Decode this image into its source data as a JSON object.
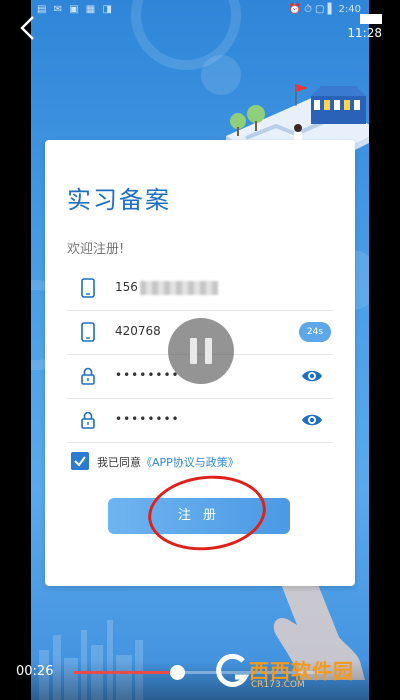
{
  "status_bar": {
    "left_icons": "▤ ✉ ▣ ▦ ◨",
    "right": "⏰ ⏱ ▢ ▌ 2:40"
  },
  "video": {
    "time_top": "11:28",
    "time_current": "00:26",
    "progress": 0.41
  },
  "page": {
    "title": "实习备案",
    "welcome": "欢迎注册!",
    "phone": "156",
    "code": "420768",
    "code_countdown": "24s",
    "password_mask": "••••••••",
    "confirm_password_mask": "••••••••",
    "agree_prefix": "我已同意",
    "agree_link": "《APP协议与政策》",
    "register_button": "注 册"
  },
  "icons": {
    "back": "back-arrow-icon",
    "phone": "phone-icon",
    "lock": "lock-icon",
    "eye": "eye-icon",
    "check": "checkbox-checked-icon",
    "pause": "pause-icon"
  },
  "watermark": {
    "brand": "西西软件园",
    "sub": "CR173.COM"
  },
  "colors": {
    "accent": "#2f86d8",
    "title": "#1e6fc2",
    "annotation_red": "#e0211b",
    "brand_orange": "#f39a1e"
  }
}
